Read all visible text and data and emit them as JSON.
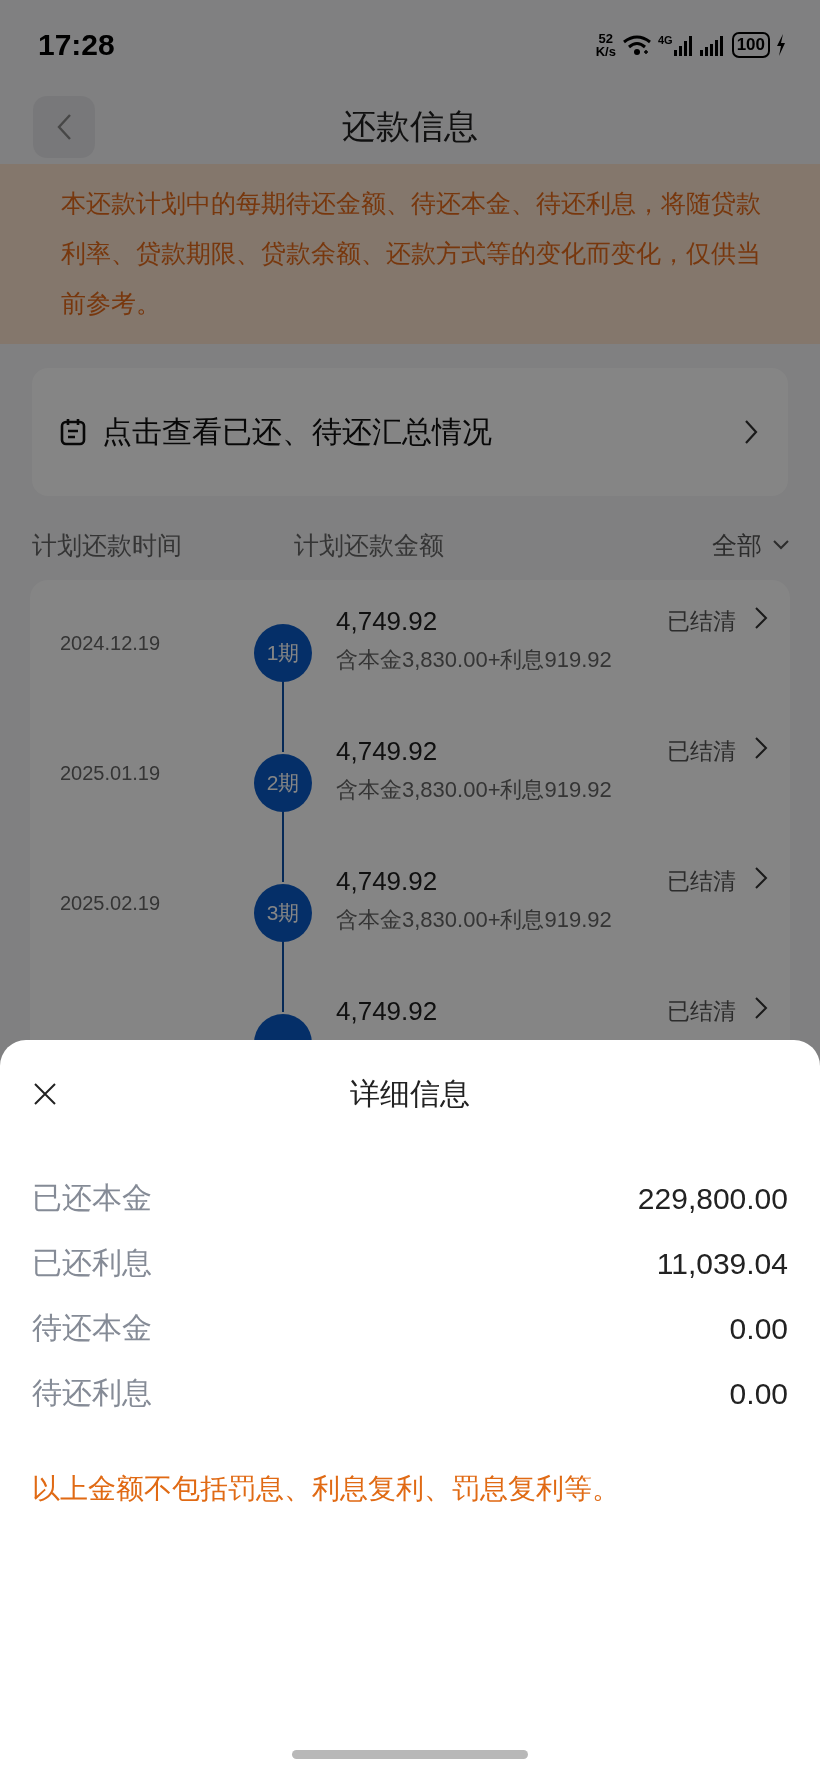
{
  "status_bar": {
    "time": "17:28",
    "net_speed": "52",
    "net_unit": "K/s",
    "network": "4G",
    "battery": "100"
  },
  "header": {
    "title": "还款信息"
  },
  "notice": {
    "text": "本还款计划中的每期待还金额、待还本金、待还利息，将随贷款利率、贷款期限、贷款余额、还款方式等的变化而变化，仅供当前参考。"
  },
  "summary_link": {
    "label": "点击查看已还、待还汇总情况"
  },
  "list_header": {
    "columns": [
      "计划还款时间",
      "计划还款金额"
    ],
    "filter": "全部"
  },
  "installments": [
    {
      "date": "2024.12.19",
      "period": "1期",
      "amount": "4,749.92",
      "breakdown": "含本金3,830.00+利息919.92",
      "status": "已结清"
    },
    {
      "date": "2025.01.19",
      "period": "2期",
      "amount": "4,749.92",
      "breakdown": "含本金3,830.00+利息919.92",
      "status": "已结清"
    },
    {
      "date": "2025.02.19",
      "period": "3期",
      "amount": "4,749.92",
      "breakdown": "含本金3,830.00+利息919.92",
      "status": "已结清"
    },
    {
      "amount": "4,749.92",
      "status": "已结清"
    }
  ],
  "sheet": {
    "title": "详细信息",
    "rows": [
      {
        "label": "已还本金",
        "value": "229,800.00"
      },
      {
        "label": "已还利息",
        "value": "11,039.04"
      },
      {
        "label": "待还本金",
        "value": "0.00"
      },
      {
        "label": "待还利息",
        "value": "0.00"
      }
    ],
    "note": "以上金额不包括罚息、利息复利、罚息复利等。"
  }
}
